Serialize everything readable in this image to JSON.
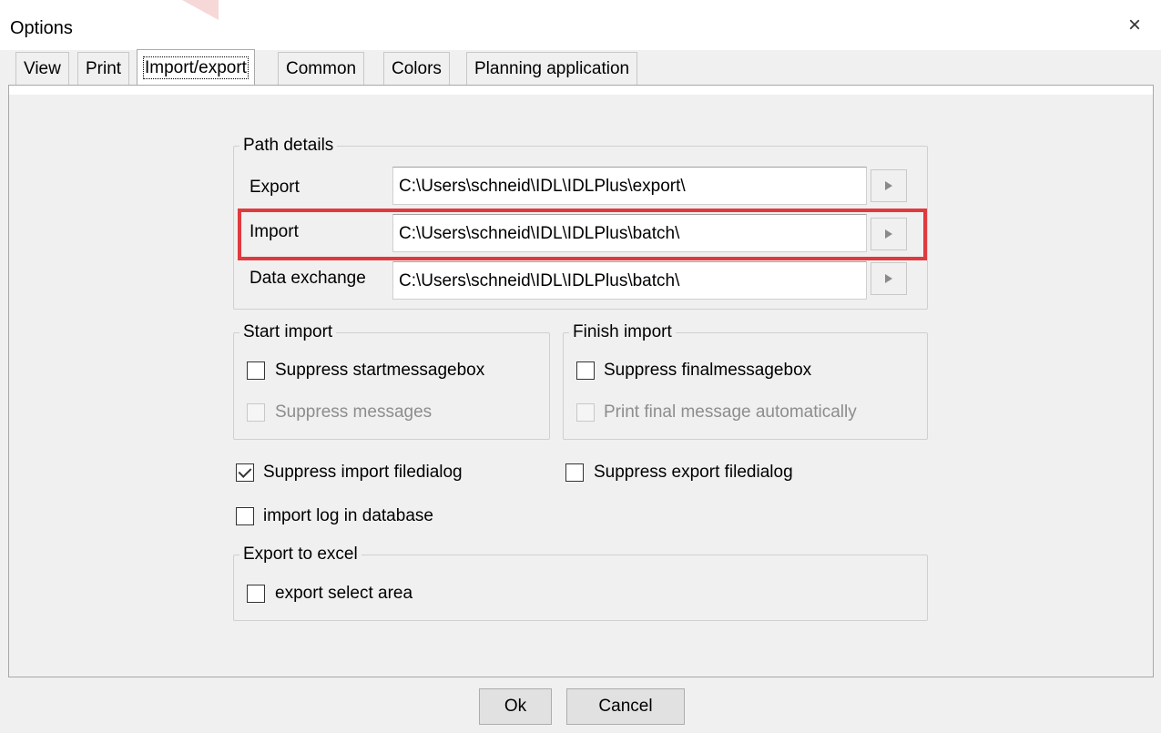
{
  "window": {
    "title": "Options",
    "close_icon": "×"
  },
  "tabs": [
    {
      "label": "View"
    },
    {
      "label": "Print"
    },
    {
      "label": "Import/export"
    },
    {
      "label": "Common"
    },
    {
      "label": "Colors"
    },
    {
      "label": "Planning application"
    }
  ],
  "active_tab": "Import/export",
  "path_details": {
    "legend": "Path details",
    "rows": [
      {
        "label": "Export",
        "value": "C:\\Users\\schneid\\IDL\\IDLPlus\\export\\"
      },
      {
        "label": "Import",
        "value": "C:\\Users\\schneid\\IDL\\IDLPlus\\batch\\"
      },
      {
        "label": "Data exchange",
        "value": "C:\\Users\\schneid\\IDL\\IDLPlus\\batch\\"
      }
    ],
    "highlighted_row": "Import",
    "highlight_color": "#e0393e"
  },
  "start_import": {
    "legend": "Start import",
    "options": [
      {
        "label": "Suppress startmessagebox",
        "checked": false,
        "enabled": true
      },
      {
        "label": "Suppress messages",
        "checked": false,
        "enabled": false
      }
    ]
  },
  "finish_import": {
    "legend": "Finish import",
    "options": [
      {
        "label": "Suppress finalmessagebox",
        "checked": false,
        "enabled": true
      },
      {
        "label": "Print final message automatically",
        "checked": false,
        "enabled": false
      }
    ]
  },
  "standalone_options": [
    {
      "label": "Suppress import filedialog",
      "checked": true
    },
    {
      "label": "Suppress export filedialog",
      "checked": false
    },
    {
      "label": "import log in database",
      "checked": false
    }
  ],
  "export_to_excel": {
    "legend": "Export to excel",
    "options": [
      {
        "label": "export select area",
        "checked": false
      }
    ]
  },
  "buttons": {
    "ok": "Ok",
    "cancel": "Cancel"
  }
}
